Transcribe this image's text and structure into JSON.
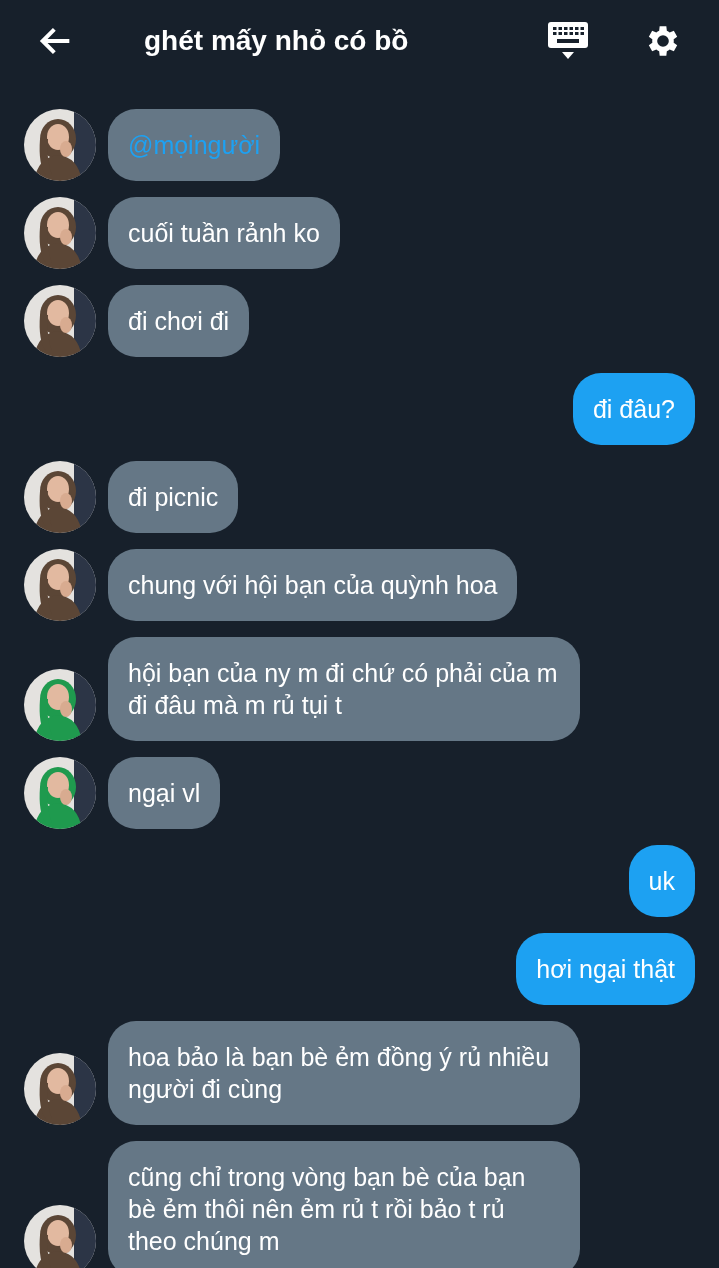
{
  "header": {
    "title": "ghét mấy nhỏ có bồ"
  },
  "messages": [
    {
      "kind": "mention",
      "outgoing": false,
      "color": "#5b4636",
      "text": "@mọingười"
    },
    {
      "kind": "text",
      "outgoing": false,
      "color": "#5b4636",
      "text": "cuối tuần rảnh ko"
    },
    {
      "kind": "text",
      "outgoing": false,
      "color": "#5b4636",
      "text": "đi chơi đi"
    },
    {
      "kind": "text",
      "outgoing": true,
      "text": "đi đâu?"
    },
    {
      "kind": "text",
      "outgoing": false,
      "color": "#5b4636",
      "text": "đi picnic"
    },
    {
      "kind": "text",
      "outgoing": false,
      "color": "#5b4636",
      "text": "chung với hội bạn của quỳnh hoa"
    },
    {
      "kind": "text",
      "outgoing": false,
      "color": "#1f9a4e",
      "text": "hội bạn của ny m đi chứ có phải của m đi đâu mà m rủ tụi t"
    },
    {
      "kind": "text",
      "outgoing": false,
      "color": "#1f9a4e",
      "text": "ngại vl"
    },
    {
      "kind": "text",
      "outgoing": true,
      "text": "uk"
    },
    {
      "kind": "text",
      "outgoing": true,
      "text": "hơi ngại thật"
    },
    {
      "kind": "text",
      "outgoing": false,
      "color": "#5b4636",
      "text": "hoa bảo là bạn bè ẻm đồng ý rủ nhiều người đi cùng"
    },
    {
      "kind": "text",
      "outgoing": false,
      "color": "#5b4636",
      "text": "cũng chỉ trong vòng bạn bè của bạn bè ẻm thôi nên ẻm rủ t rồi bảo t rủ theo chúng m"
    }
  ]
}
